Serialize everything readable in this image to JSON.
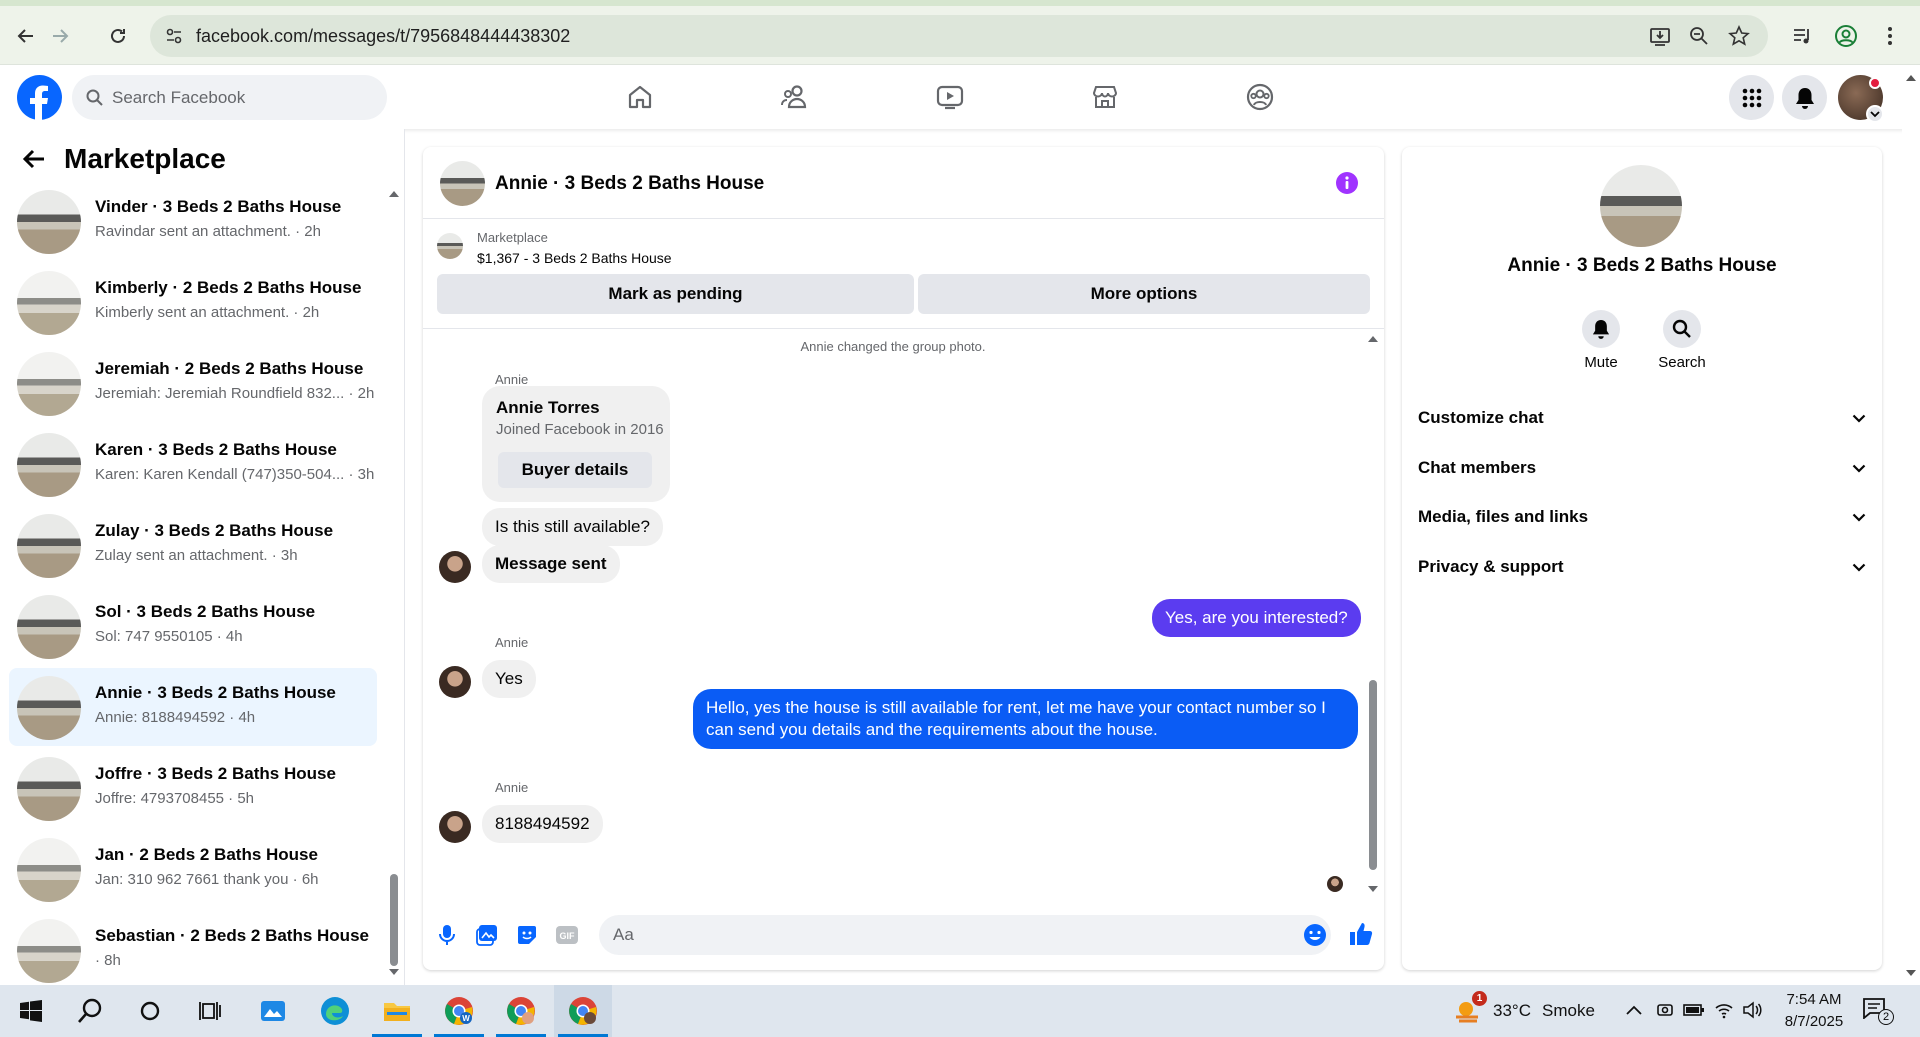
{
  "browser": {
    "url": "facebook.com/messages/t/7956848444438302"
  },
  "fb_header": {
    "search_placeholder": "Search Facebook"
  },
  "left": {
    "title": "Marketplace",
    "conversations": [
      {
        "name": "Vinder · 3 Beds 2 Baths House",
        "preview": "Ravindar sent an attachment. · 2h",
        "selected": false
      },
      {
        "name": "Kimberly · 2 Beds 2 Baths House",
        "preview": "Kimberly sent an attachment. · 2h",
        "selected": false
      },
      {
        "name": "Jeremiah · 2 Beds 2 Baths House",
        "preview": "Jeremiah: Jeremiah Roundfield 832... · 2h",
        "selected": false
      },
      {
        "name": "Karen · 3 Beds 2 Baths House",
        "preview": "Karen: Karen Kendall (747)350-504... · 3h",
        "selected": false
      },
      {
        "name": "Zulay · 3 Beds 2 Baths House",
        "preview": "Zulay sent an attachment. · 3h",
        "selected": false
      },
      {
        "name": "Sol · 3 Beds 2 Baths House",
        "preview": "Sol: 747 9550105 · 4h",
        "selected": false
      },
      {
        "name": "Annie · 3 Beds 2 Baths House",
        "preview": "Annie: 8188494592 · 4h",
        "selected": true
      },
      {
        "name": "Joffre · 3 Beds 2 Baths House",
        "preview": "Joffre: 4793708455 · 5h",
        "selected": false
      },
      {
        "name": "Jan · 2 Beds 2 Baths House",
        "preview": "Jan: 310 962 7661 thank you · 6h",
        "selected": false
      },
      {
        "name": "Sebastian · 2 Beds 2 Baths House",
        "preview": "· 8h",
        "selected": false
      }
    ]
  },
  "chat": {
    "title": "Annie · 3 Beds 2 Baths House",
    "marketplace_label": "Marketplace",
    "listing": "$1,367 - 3 Beds 2 Baths House",
    "mark_pending": "Mark as pending",
    "more_options": "More options",
    "system_msg": "Annie changed the group photo.",
    "sender_name": "Annie",
    "card_name": "Annie Torres",
    "card_joined": "Joined Facebook in 2016",
    "card_button": "Buyer details",
    "msg1": "Is this still available?",
    "msg2": "Message sent",
    "msg3": "Yes, are you interested?",
    "msg4": "Yes",
    "msg5": "Hello, yes the house is still available for rent, let me have your contact number so I can send you details and the requirements about the house.",
    "msg6": "8188494592",
    "composer_placeholder": "Aa"
  },
  "info": {
    "title": "Annie · 3 Beds 2 Baths House",
    "mute": "Mute",
    "search": "Search",
    "sections": [
      "Customize chat",
      "Chat members",
      "Media, files and links",
      "Privacy & support"
    ]
  },
  "taskbar": {
    "weather_temp": "33°C",
    "weather_desc": "Smoke",
    "weather_badge": "1",
    "time": "7:54 AM",
    "date": "8/7/2025",
    "notif_count": "2"
  },
  "colors": {
    "fb_blue": "#0866ff",
    "outgoing_purple": "#5b3cf0",
    "outgoing_blue": "#0a5cf5",
    "info_purple": "#a033ff",
    "selected_bg": "#ebf5ff"
  }
}
